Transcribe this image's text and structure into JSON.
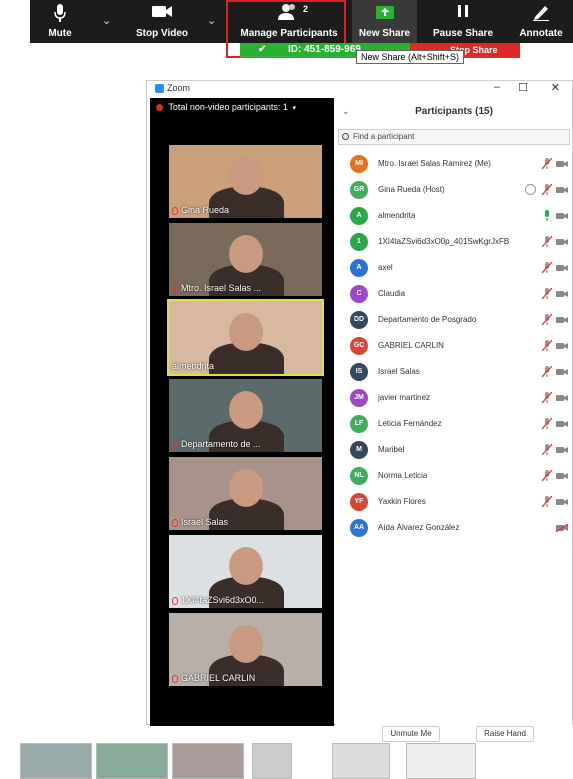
{
  "toolbar": {
    "mute_label": "Mute",
    "stop_video_label": "Stop Video",
    "manage_participants_label": "Manage Participants",
    "participant_count": "2",
    "new_share_label": "New Share",
    "pause_share_label": "Pause Share",
    "annotate_label": "Annotate",
    "meeting_id": "ID: 451-859-969",
    "stop_share_label": "Stop Share",
    "tooltip": "New Share (Alt+Shift+S)"
  },
  "window": {
    "title": "Zoom",
    "minimize": "–",
    "maximize": "☐",
    "close": "✕"
  },
  "video_strip": {
    "header": "Total non-video participants: 1",
    "recording_label": "Recording...",
    "tiles": [
      {
        "name": "Gina Rueda",
        "muted": true
      },
      {
        "name": "Mtro. Israel Salas ...",
        "muted": true
      },
      {
        "name": "almendrita",
        "muted": false,
        "active": true
      },
      {
        "name": "Departamento de ...",
        "muted": true
      },
      {
        "name": "Israel Salas",
        "muted": true
      },
      {
        "name": "1XI4taZSvi6d3xO0...",
        "muted": true
      },
      {
        "name": "GABRIEL CARLIN",
        "muted": true
      }
    ]
  },
  "participants": {
    "title": "Participants (15)",
    "search_placeholder": "Find a participant",
    "list": [
      {
        "initials": "MI",
        "name": "Mtro. Israel Salas Ramirez (Me)",
        "color": "#e8711c",
        "mic": "muted",
        "cam": "on"
      },
      {
        "initials": "GR",
        "name": "Gina Rueda (Host)",
        "color": "#3fae5c",
        "mic": "muted",
        "cam": "on",
        "host": true
      },
      {
        "initials": "A",
        "name": "almendrita",
        "color": "#2aa848",
        "mic": "on",
        "cam": "on"
      },
      {
        "initials": "1",
        "name": "1XI4taZSvi6d3xO0p_401SwKgrJxFB",
        "color": "#2aa848",
        "mic": "muted",
        "cam": "on"
      },
      {
        "initials": "A",
        "name": "axel",
        "color": "#2d73d4",
        "mic": "muted",
        "cam": "on"
      },
      {
        "initials": "C",
        "name": "Claudia",
        "color": "#a047c8",
        "mic": "muted",
        "cam": "on"
      },
      {
        "initials": "DD",
        "name": "Departamento de Posgrado",
        "color": "#34495e",
        "mic": "muted",
        "cam": "on"
      },
      {
        "initials": "GC",
        "name": "GABRIEL CARLIN",
        "color": "#d94535",
        "mic": "muted",
        "cam": "on"
      },
      {
        "initials": "IS",
        "name": "Israel Salas",
        "color": "#34495e",
        "mic": "muted",
        "cam": "on"
      },
      {
        "initials": "JM",
        "name": "javier martinez",
        "color": "#a047c8",
        "mic": "muted",
        "cam": "on"
      },
      {
        "initials": "LF",
        "name": "Leticia Fernández",
        "color": "#3fae5c",
        "mic": "muted",
        "cam": "on"
      },
      {
        "initials": "M",
        "name": "Maribel",
        "color": "#34495e",
        "mic": "muted",
        "cam": "on"
      },
      {
        "initials": "NL",
        "name": "Norma Leticia",
        "color": "#3fae5c",
        "mic": "muted",
        "cam": "on"
      },
      {
        "initials": "YF",
        "name": "Yaxkin Flores",
        "color": "#d94535",
        "mic": "muted",
        "cam": "on"
      },
      {
        "initials": "AA",
        "name": "Aída Álvarez González",
        "color": "#2d73d4",
        "mic": "none",
        "cam": "off"
      }
    ],
    "unmute_label": "Unmute Me",
    "raise_hand_label": "Raise Hand"
  }
}
